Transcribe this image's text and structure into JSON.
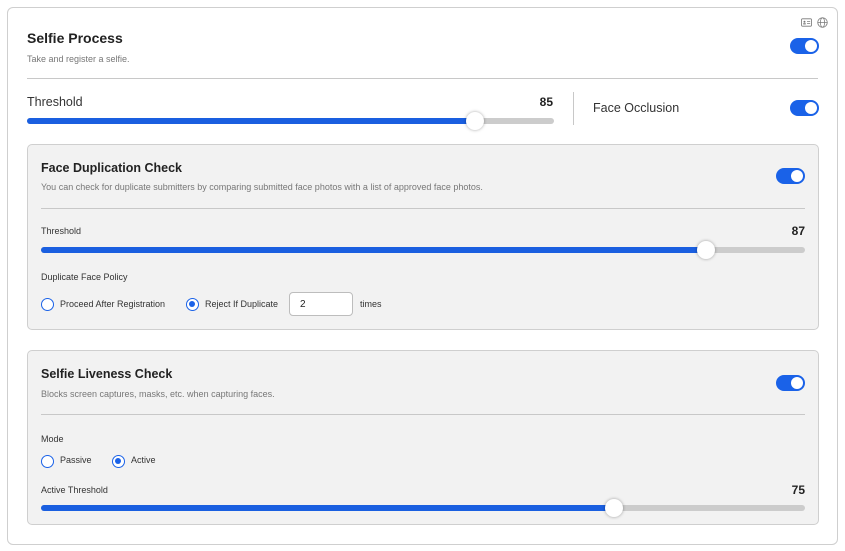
{
  "selfie": {
    "title": "Selfie Process",
    "description": "Take and register a selfie.",
    "enabled": true,
    "threshold": {
      "label": "Threshold",
      "value": 85
    },
    "face_occlusion": {
      "label": "Face Occlusion",
      "enabled": true
    }
  },
  "duplication": {
    "title": "Face Duplication Check",
    "description": "You can check for duplicate submitters by comparing submitted face photos with a list of approved face photos.",
    "enabled": true,
    "threshold": {
      "label": "Threshold",
      "value": 87
    },
    "policy_label": "Duplicate Face Policy",
    "options": [
      {
        "label": "Proceed After Registration",
        "selected": false
      },
      {
        "label": "Reject If Duplicate",
        "selected": true
      }
    ],
    "times_value": "2",
    "times_label": "times"
  },
  "liveness": {
    "title": "Selfie Liveness Check",
    "description": "Blocks screen captures, masks, etc. when capturing faces.",
    "enabled": true,
    "mode_label": "Mode",
    "modes": [
      {
        "label": "Passive",
        "selected": false
      },
      {
        "label": "Active",
        "selected": true
      }
    ],
    "active_threshold": {
      "label": "Active Threshold",
      "value": 75
    }
  },
  "top_icons": [
    "id-card-icon",
    "globe-icon"
  ],
  "colors": {
    "accent": "#1a62e8",
    "track": "#cccccc",
    "panel": "#f2f2f2"
  }
}
